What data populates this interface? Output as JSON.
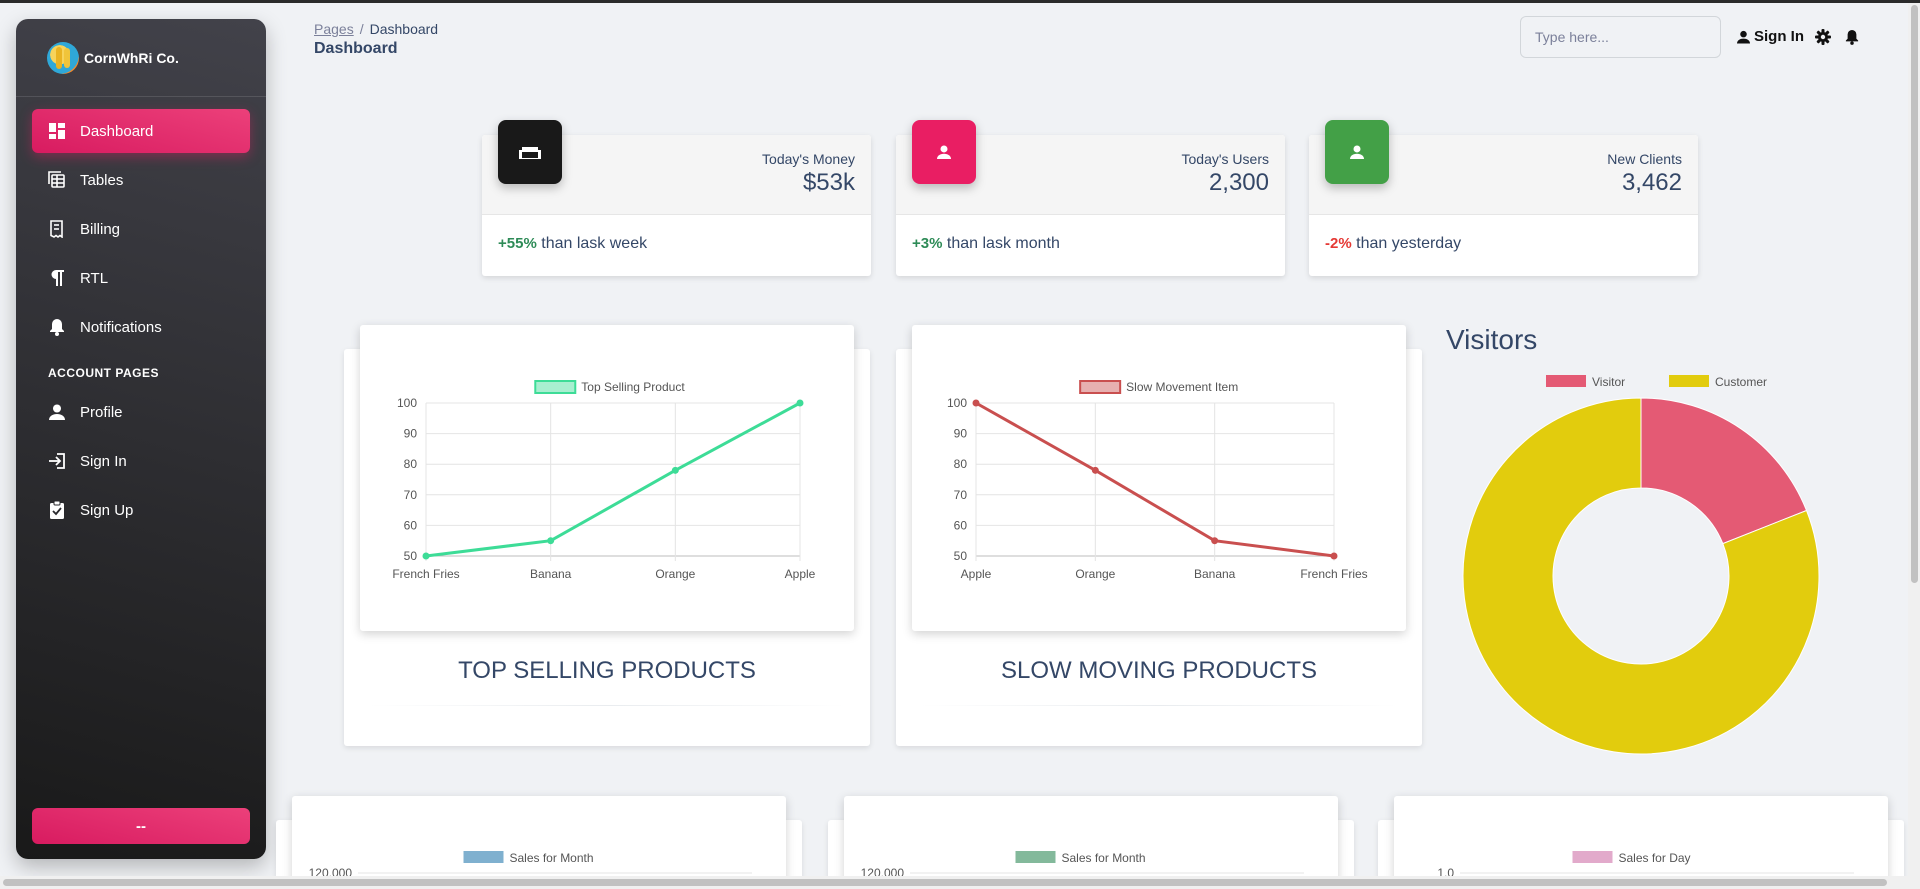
{
  "brand": {
    "name": "CornWhRi Co."
  },
  "sidebar": {
    "items": [
      {
        "label": "Dashboard",
        "icon": "dashboard-icon"
      },
      {
        "label": "Tables",
        "icon": "table-icon"
      },
      {
        "label": "Billing",
        "icon": "receipt-icon"
      },
      {
        "label": "RTL",
        "icon": "pilcrow-icon"
      },
      {
        "label": "Notifications",
        "icon": "bell-icon"
      }
    ],
    "section_title": "ACCOUNT PAGES",
    "account_items": [
      {
        "label": "Profile",
        "icon": "person-icon"
      },
      {
        "label": "Sign In",
        "icon": "login-icon"
      },
      {
        "label": "Sign Up",
        "icon": "clipboard-icon"
      }
    ],
    "bottom_button": "--"
  },
  "header": {
    "breadcrumb_root": "Pages",
    "breadcrumb_sep": "/",
    "breadcrumb_current": "Dashboard",
    "title": "Dashboard",
    "search_placeholder": "Type here...",
    "signin_label": "Sign In"
  },
  "stats": [
    {
      "label": "Today's Money",
      "value": "$53k",
      "pct": "+55%",
      "note": "than lask week",
      "color": "#191919",
      "icon": "weekend-icon"
    },
    {
      "label": "Today's Users",
      "value": "2,300",
      "pct": "+3%",
      "note": "than lask month",
      "color": "#e91e63",
      "icon": "person-icon"
    },
    {
      "label": "New Clients",
      "value": "3,462",
      "pct": "-2%",
      "note": "than yesterday",
      "color": "#43a047",
      "icon": "person-icon"
    }
  ],
  "cards": {
    "top_title": "TOP SELLING PRODUCTS",
    "slow_title": "SLOW MOVING PRODUCTS",
    "visitors_title": "Visitors"
  },
  "chart_data": [
    {
      "type": "line",
      "categories": [
        "French Fries",
        "Banana",
        "Orange",
        "Apple"
      ],
      "series": [
        {
          "name": "Top Selling Product",
          "values": [
            50,
            55,
            78,
            100
          ],
          "color": "#3ddc97"
        }
      ],
      "ylim": [
        50,
        100
      ],
      "yticks": [
        50,
        60,
        70,
        80,
        90,
        100
      ],
      "grid": true,
      "legend": "top"
    },
    {
      "type": "line",
      "categories": [
        "Apple",
        "Orange",
        "Banana",
        "French Fries"
      ],
      "series": [
        {
          "name": "Slow Movement Item",
          "values": [
            100,
            78,
            55,
            50
          ],
          "color": "#c94f4f"
        }
      ],
      "ylim": [
        50,
        100
      ],
      "yticks": [
        50,
        60,
        70,
        80,
        90,
        100
      ],
      "grid": true,
      "legend": "top"
    },
    {
      "type": "pie",
      "categories": [
        "Visitor",
        "Customer"
      ],
      "values": [
        19,
        81
      ],
      "colors": [
        "#e45a74",
        "#e2cc0d"
      ],
      "legend": "top"
    },
    {
      "type": "bar",
      "series": [
        {
          "name": "Sales for Month",
          "color": "#7fb0cf"
        }
      ],
      "yticks_visible": [
        "120,000"
      ],
      "legend": "top"
    },
    {
      "type": "bar",
      "series": [
        {
          "name": "Sales for Month",
          "color": "#83b99b"
        }
      ],
      "yticks_visible": [
        "120,000"
      ],
      "legend": "top"
    },
    {
      "type": "bar",
      "series": [
        {
          "name": "Sales for Day",
          "color": "#e2aacb"
        }
      ],
      "yticks_visible": [
        "1.0"
      ],
      "legend": "top"
    }
  ]
}
